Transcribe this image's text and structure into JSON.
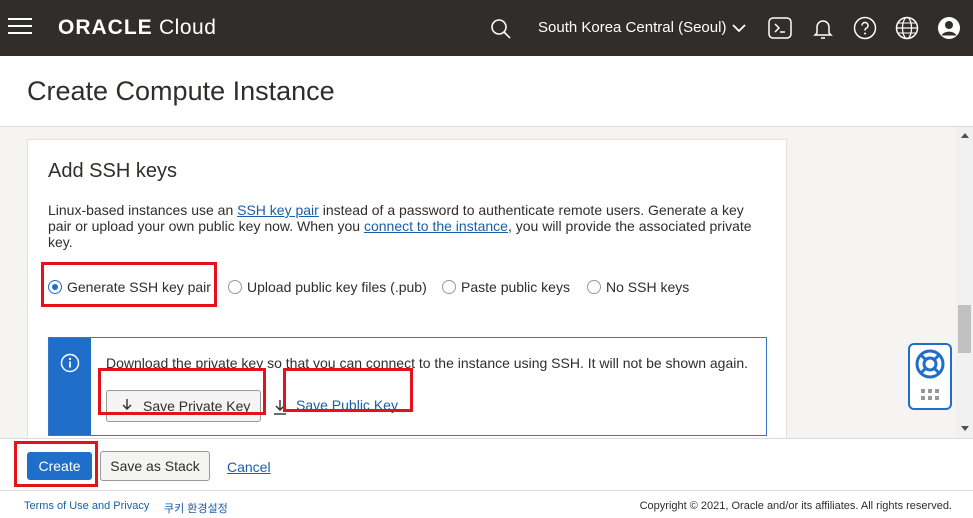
{
  "topbar": {
    "brand_primary": "ORACLE",
    "brand_secondary": "Cloud",
    "region": "South Korea Central (Seoul)"
  },
  "header": {
    "title": "Create Compute Instance"
  },
  "ssh_section": {
    "title": "Add SSH keys",
    "desc_part1": "Linux-based instances use an ",
    "desc_link1": "SSH key pair",
    "desc_part2": " instead of a password to authenticate remote users. Generate a key pair or upload your own public key now. When you ",
    "desc_link2": "connect to the instance",
    "desc_part3": ", you will provide the associated private key.",
    "options": [
      {
        "label": "Generate SSH key pair",
        "selected": true
      },
      {
        "label": "Upload public key files (.pub)",
        "selected": false
      },
      {
        "label": "Paste public keys",
        "selected": false
      },
      {
        "label": "No SSH keys",
        "selected": false
      }
    ],
    "info_text": "Download the private key so that you can connect to the instance using SSH. It will not be shown again.",
    "save_private_label": "Save Private Key",
    "save_public_label": "Save Public Key"
  },
  "actions": {
    "create_label": "Create",
    "save_stack_label": "Save as Stack",
    "cancel_label": "Cancel"
  },
  "footer": {
    "terms": "Terms of Use and Privacy",
    "cookie": "쿠키 환경설정",
    "copyright": "Copyright © 2021, Oracle and/or its affiliates. All rights reserved."
  },
  "colors": {
    "topbar": "#312d2a",
    "accent": "#1f6ec9",
    "link": "#1a5ea7",
    "highlight": "#e3121b"
  }
}
